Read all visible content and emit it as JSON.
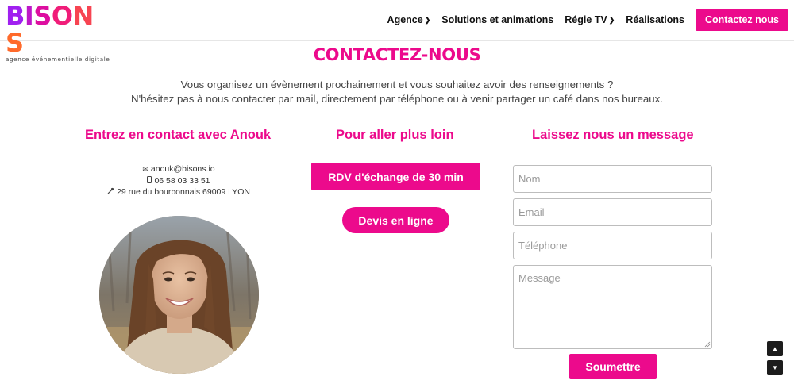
{
  "brand": {
    "logo_text": "BISONS",
    "tagline": "agence événementielle digitale",
    "colors": {
      "primary": "#ec0a8c",
      "logo_gradient": [
        "#a020f0",
        "#ec0a8c",
        "#ff6a2b"
      ]
    }
  },
  "nav": {
    "items": [
      {
        "label": "Agence",
        "has_dropdown": true
      },
      {
        "label": "Solutions et animations",
        "has_dropdown": false
      },
      {
        "label": "Régie TV",
        "has_dropdown": true
      },
      {
        "label": "Réalisations",
        "has_dropdown": false
      }
    ],
    "cta_label": "Contactez nous"
  },
  "page": {
    "title": "CONTACTEZ-NOUS",
    "intro_line1": "Vous organisez un évènement prochainement et vous souhaitez avoir des renseignements ?",
    "intro_line2": "N'hésitez pas à nous contacter par mail, directement par téléphone ou à venir partager un café dans nos bureaux."
  },
  "contact": {
    "heading": "Entrez en contact avec Anouk",
    "email": "anouk@bisons.io",
    "phone": "06 58 03 33 51",
    "address": "29 rue du bourbonnais 69009 LYON",
    "icons": [
      "envelope-icon",
      "phone-icon",
      "location-pin-icon"
    ]
  },
  "more": {
    "heading": "Pour aller plus loin",
    "rdv_label": "RDV d'échange de 30 min",
    "devis_label": "Devis en ligne"
  },
  "form": {
    "heading": "Laissez nous un message",
    "name_placeholder": "Nom",
    "email_placeholder": "Email",
    "phone_placeholder": "Téléphone",
    "message_placeholder": "Message",
    "submit_label": "Soumettre"
  },
  "scroll": {
    "up_icon": "▲",
    "down_icon": "▼"
  }
}
